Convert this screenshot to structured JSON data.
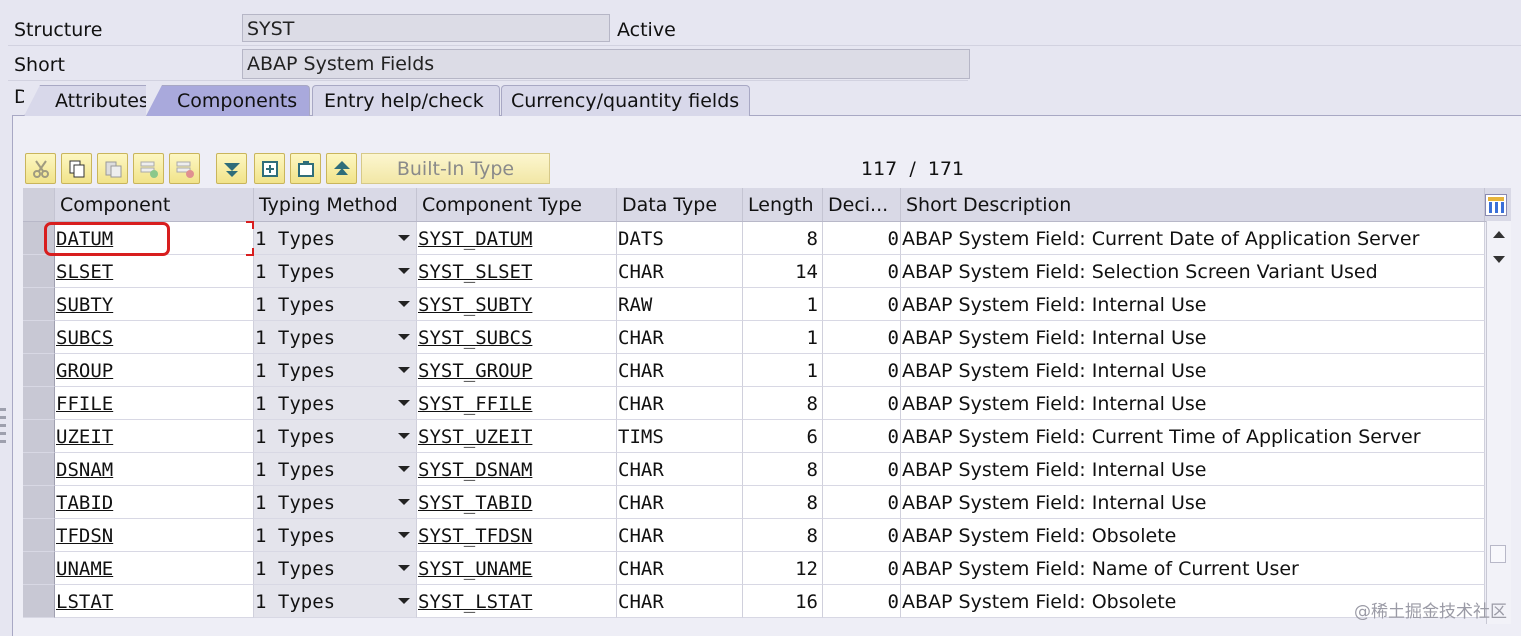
{
  "header": {
    "structure_label": "Structure",
    "structure_value": "SYST",
    "status": "Active",
    "short_desc_label": "Short Description",
    "short_desc_value": "ABAP System Fields"
  },
  "tabs": [
    {
      "label": "Attributes",
      "active": false
    },
    {
      "label": "Components",
      "active": true
    },
    {
      "label": "Entry help/check",
      "active": false
    },
    {
      "label": "Currency/quantity fields",
      "active": false
    }
  ],
  "toolbar": {
    "icons": [
      "cut-icon",
      "copy-icon",
      "paste-icon",
      "insert-row-icon",
      "delete-row-icon",
      "move-down-icon",
      "insert-icon",
      "copy-row-icon",
      "move-up-icon"
    ],
    "builtin_type_label": "Built-In Type",
    "counter": "117  /  171"
  },
  "table": {
    "columns": [
      "Component",
      "Typing Method",
      "Component Type",
      "Data Type",
      "Length",
      "Deci...",
      "Short Description"
    ],
    "rows": [
      {
        "component": "DATUM",
        "typing": "1 Types",
        "ctype": "SYST_DATUM",
        "dtype": "DATS",
        "length": "8",
        "decimals": "0",
        "desc": "ABAP System Field: Current Date of Application Server"
      },
      {
        "component": "SLSET",
        "typing": "1 Types",
        "ctype": "SYST_SLSET",
        "dtype": "CHAR",
        "length": "14",
        "decimals": "0",
        "desc": "ABAP System Field: Selection Screen Variant Used"
      },
      {
        "component": "SUBTY",
        "typing": "1 Types",
        "ctype": "SYST_SUBTY",
        "dtype": "RAW",
        "length": "1",
        "decimals": "0",
        "desc": "ABAP System Field: Internal Use"
      },
      {
        "component": "SUBCS",
        "typing": "1 Types",
        "ctype": "SYST_SUBCS",
        "dtype": "CHAR",
        "length": "1",
        "decimals": "0",
        "desc": "ABAP System Field: Internal Use"
      },
      {
        "component": "GROUP",
        "typing": "1 Types",
        "ctype": "SYST_GROUP",
        "dtype": "CHAR",
        "length": "1",
        "decimals": "0",
        "desc": "ABAP System Field: Internal Use"
      },
      {
        "component": "FFILE",
        "typing": "1 Types",
        "ctype": "SYST_FFILE",
        "dtype": "CHAR",
        "length": "8",
        "decimals": "0",
        "desc": "ABAP System Field: Internal Use"
      },
      {
        "component": "UZEIT",
        "typing": "1 Types",
        "ctype": "SYST_UZEIT",
        "dtype": "TIMS",
        "length": "6",
        "decimals": "0",
        "desc": "ABAP System Field: Current Time of Application Server"
      },
      {
        "component": "DSNAM",
        "typing": "1 Types",
        "ctype": "SYST_DSNAM",
        "dtype": "CHAR",
        "length": "8",
        "decimals": "0",
        "desc": "ABAP System Field: Internal Use"
      },
      {
        "component": "TABID",
        "typing": "1 Types",
        "ctype": "SYST_TABID",
        "dtype": "CHAR",
        "length": "8",
        "decimals": "0",
        "desc": "ABAP System Field: Internal Use"
      },
      {
        "component": "TFDSN",
        "typing": "1 Types",
        "ctype": "SYST_TFDSN",
        "dtype": "CHAR",
        "length": "8",
        "decimals": "0",
        "desc": "ABAP System Field: Obsolete"
      },
      {
        "component": "UNAME",
        "typing": "1 Types",
        "ctype": "SYST_UNAME",
        "dtype": "CHAR",
        "length": "12",
        "decimals": "0",
        "desc": "ABAP System Field: Name of Current User"
      },
      {
        "component": "LSTAT",
        "typing": "1 Types",
        "ctype": "SYST_LSTAT",
        "dtype": "CHAR",
        "length": "16",
        "decimals": "0",
        "desc": "ABAP System Field: Obsolete"
      }
    ]
  },
  "watermark": "@稀土掘金技术社区",
  "colors": {
    "highlight": "#d81e1e",
    "active_tab": "#a9a9dc",
    "toolbar_button": "#f1e38a"
  }
}
